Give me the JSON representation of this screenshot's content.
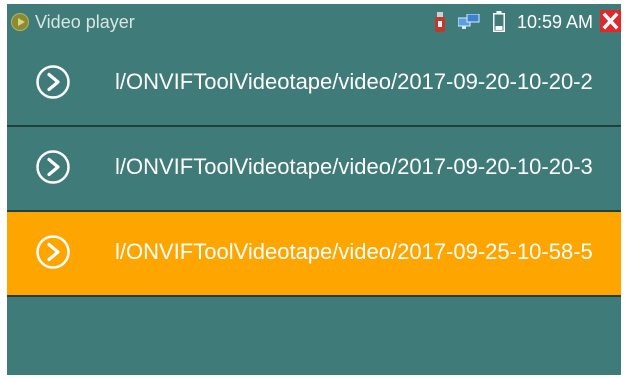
{
  "statusbar": {
    "app_title": "Video player",
    "time": "10:59 AM",
    "icons": [
      "app-icon",
      "usb-icon",
      "network-icon",
      "battery-icon",
      "close-icon"
    ]
  },
  "files": [
    {
      "path": "l/ONVIFToolVideotape/video/2017-09-20-10-20-2",
      "selected": false
    },
    {
      "path": "l/ONVIFToolVideotape/video/2017-09-20-10-20-3",
      "selected": false
    },
    {
      "path": "l/ONVIFToolVideotape/video/2017-09-25-10-58-5",
      "selected": true
    }
  ],
  "colors": {
    "background": "#3f7b78",
    "selected_row": "#ffa500",
    "divider": "#20403e",
    "text": "#ffffff",
    "close_red": "#e0282a"
  }
}
